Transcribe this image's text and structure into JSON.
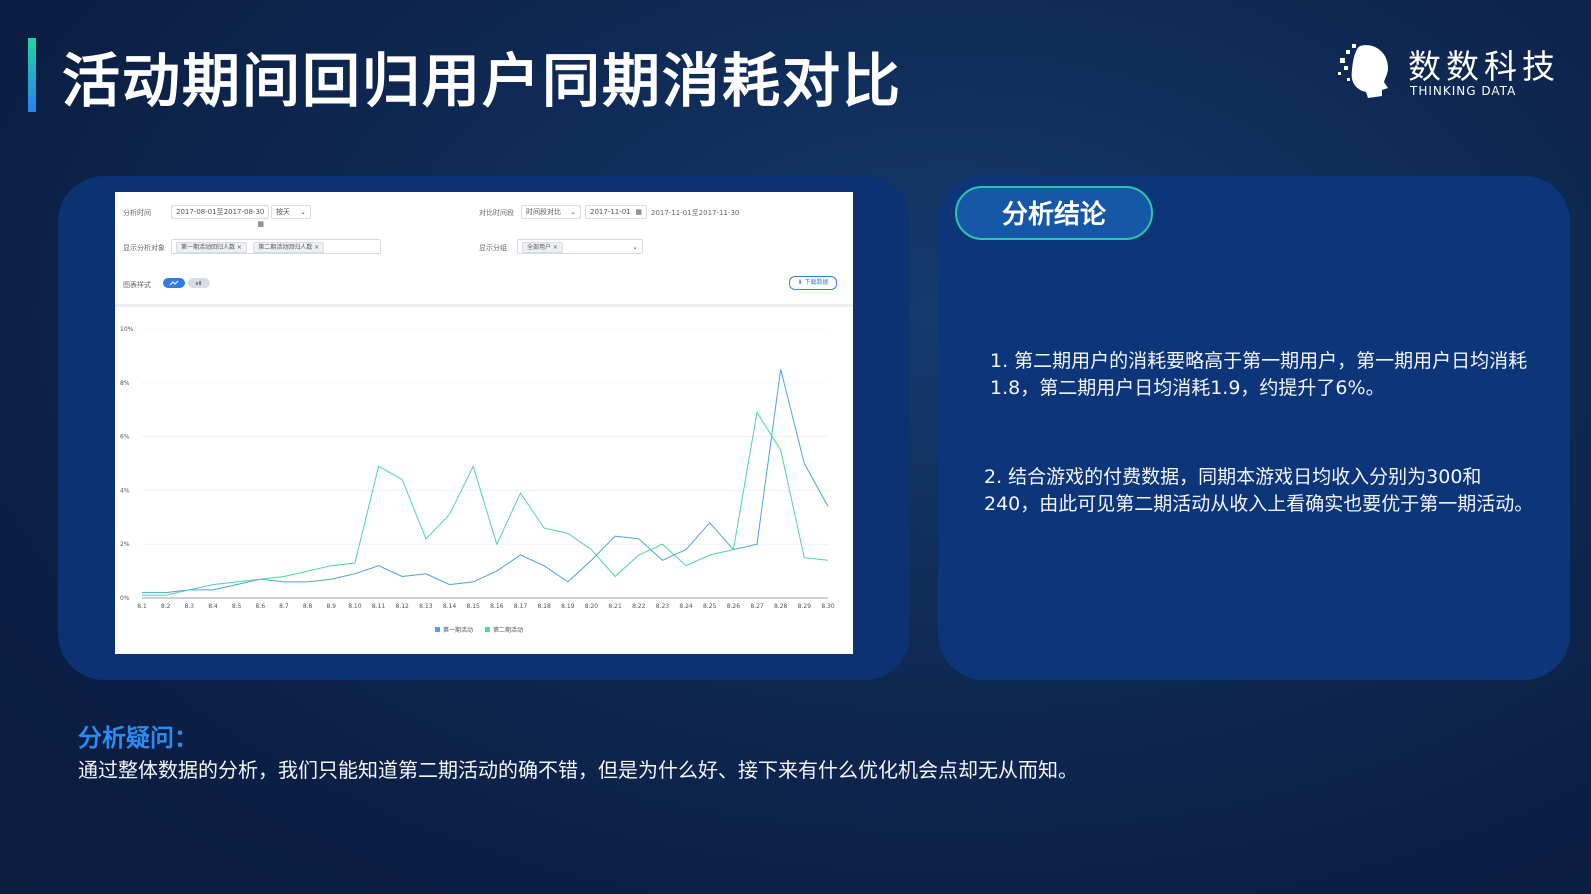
{
  "slide": {
    "title": "活动期间回归用户同期消耗对比"
  },
  "logo": {
    "cn": "数数科技",
    "en": "THINKING DATA"
  },
  "filters": {
    "row1": {
      "label_left": "分析时间",
      "date_range": "2017-08-01至2017-08-30",
      "granularity": "按天",
      "label_right": "对比时间段",
      "compare_mode": "时间段对比",
      "compare_date": "2017-11-01",
      "compare_range": "2017-11-01至2017-11-30"
    },
    "row2": {
      "label_left": "显示分析对象",
      "chip1": "第一期活动回归人数",
      "chip2": "第二期活动回归人数",
      "label_right": "显示分组",
      "chip3": "全部用户"
    },
    "row3": {
      "label": "图表样式",
      "download": "下载数据"
    }
  },
  "chart_data": {
    "type": "line",
    "x": [
      "8.1",
      "8.2",
      "8.3",
      "8.4",
      "8.5",
      "8.6",
      "8.7",
      "8.8",
      "8.9",
      "8.10",
      "8.11",
      "8.12",
      "8.13",
      "8.14",
      "8.15",
      "8.16",
      "8.17",
      "8.18",
      "8.19",
      "8.20",
      "8.21",
      "8.22",
      "8.23",
      "8.24",
      "8.25",
      "8.26",
      "8.27",
      "8.28",
      "8.29",
      "8.30"
    ],
    "ylim": [
      0,
      10
    ],
    "y_ticks": [
      "0%",
      "2%",
      "4%",
      "6%",
      "8%",
      "10%"
    ],
    "series": [
      {
        "name": "第一期活动",
        "color": "#4aa3e8",
        "values": [
          0.2,
          0.2,
          0.3,
          0.3,
          0.5,
          0.7,
          0.6,
          0.6,
          0.7,
          0.9,
          1.2,
          0.8,
          0.9,
          0.5,
          0.6,
          1.0,
          1.6,
          1.2,
          0.6,
          1.4,
          2.3,
          2.2,
          1.4,
          1.8,
          2.8,
          1.8,
          2.0,
          8.5,
          5.0,
          3.4
        ]
      },
      {
        "name": "第二期活动",
        "color": "#4cd99a",
        "values": [
          0.1,
          0.1,
          0.3,
          0.5,
          0.6,
          0.7,
          0.8,
          1.0,
          1.2,
          1.3,
          4.9,
          4.4,
          2.2,
          3.1,
          4.9,
          2.0,
          3.9,
          2.6,
          2.4,
          1.8,
          0.8,
          1.6,
          2.0,
          1.2,
          1.6,
          1.8,
          6.9,
          5.5,
          1.5,
          1.4
        ]
      }
    ]
  },
  "analysis": {
    "tag": "分析结论",
    "point1": "1. 第二期用户的消耗要略高于第一期用户，第一期用户日均消耗1.8，第二期用户日均消耗1.9，约提升了6%。",
    "point2": "2. 结合游戏的付费数据，同期本游戏日均收入分别为300和240，由此可见第二期活动从收入上看确实也要优于第一期活动。"
  },
  "question": {
    "title": "分析疑问：",
    "text": "通过整体数据的分析，我们只能知道第二期活动的确不错，但是为什么好、接下来有什么优化机会点却无从而知。"
  }
}
